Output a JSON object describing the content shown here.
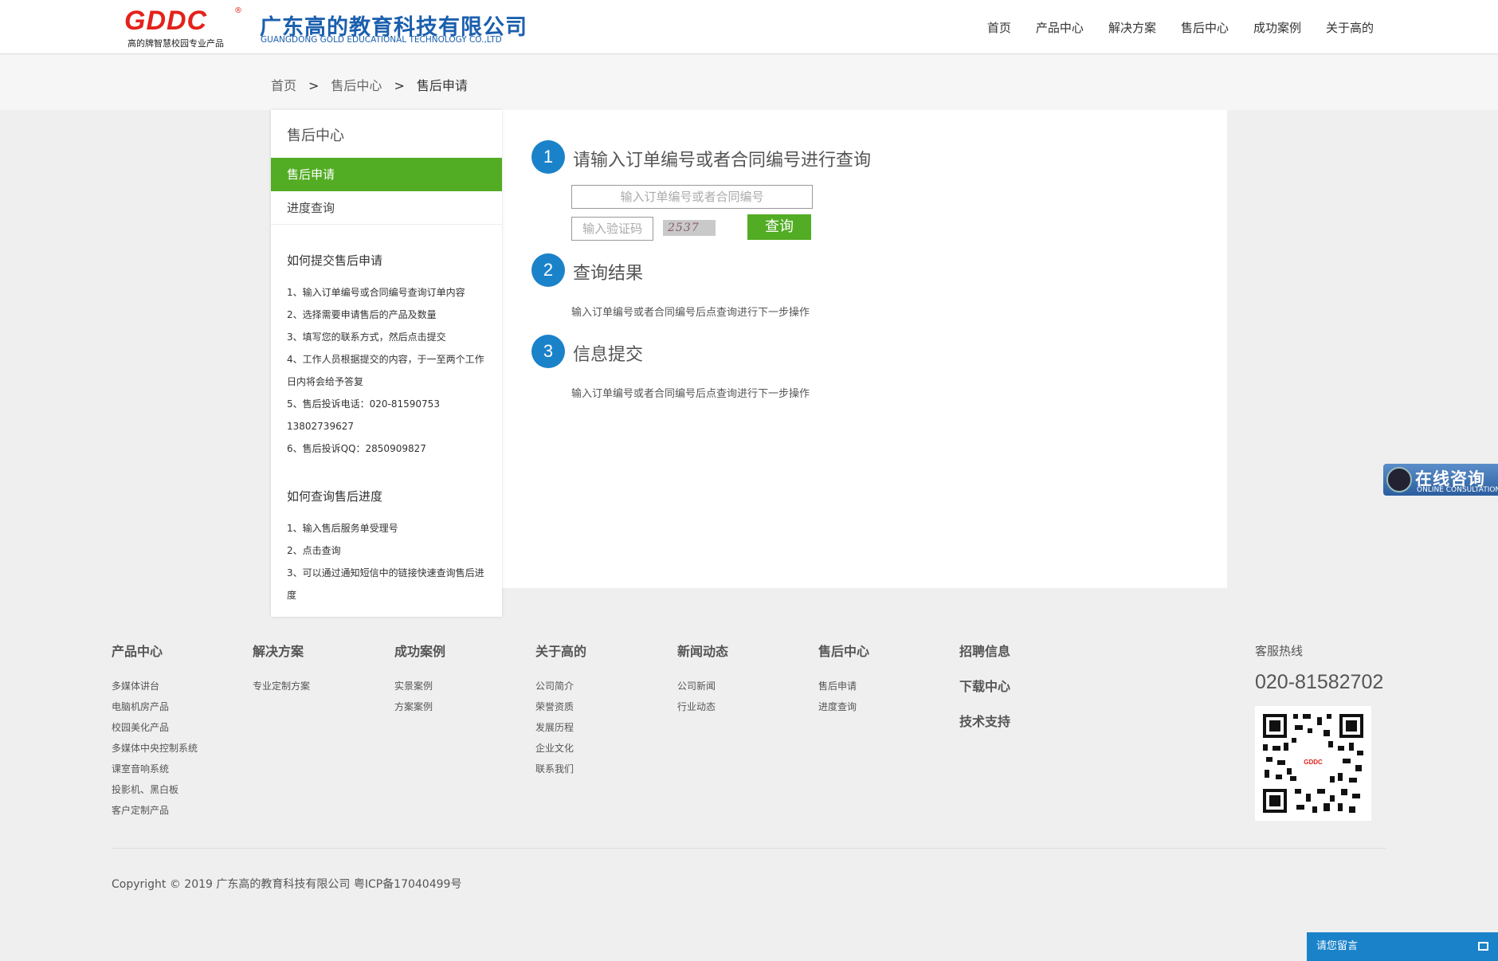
{
  "header": {
    "logo_mark": "GDDC",
    "logo_reg": "®",
    "logo_sub": "高的牌智慧校园专业产品",
    "company_cn": "广东高的教育科技有限公司",
    "company_en": "GUANGDONG GOLD EDUCATIONAL TECHNOLOGY CO.,LTD",
    "nav": [
      "首页",
      "产品中心",
      "解决方案",
      "售后中心",
      "成功案例",
      "关于高的"
    ]
  },
  "breadcrumb": {
    "home": "首页",
    "sep": ">",
    "section": "售后中心",
    "current": "售后申请"
  },
  "sidebar": {
    "title": "售后中心",
    "items": [
      "售后申请",
      "进度查询"
    ],
    "howto_submit": {
      "title": "如何提交售后申请",
      "lines": [
        "1、输入订单编号或合同编号查询订单内容",
        "2、选择需要申请售后的产品及数量",
        "3、填写您的联系方式，然后点击提交",
        "4、工作人员根据提交的内容，于一至两个工作",
        "日内将会给予答复",
        "5、售后投诉电话：020-81590753",
        "13802739627",
        "6、售后投诉QQ：2850909827"
      ]
    },
    "howto_query": {
      "title": "如何查询售后进度",
      "lines": [
        "1、输入售后服务单受理号",
        "2、点击查询",
        "3、可以通过通知短信中的链接快速查询售后进",
        "度"
      ]
    }
  },
  "steps": [
    {
      "num": "1",
      "title": "请输入订单编号或者合同编号进行查询"
    },
    {
      "num": "2",
      "title": "查询结果"
    },
    {
      "num": "3",
      "title": "信息提交"
    }
  ],
  "form": {
    "order_placeholder": "输入订单编号或者合同编号",
    "code_placeholder": "输入验证码",
    "captcha": "2537",
    "query_button": "查询"
  },
  "hints": {
    "result": "输入订单编号或者合同编号后点查询进行下一步操作",
    "submit": "输入订单编号或者合同编号后点查询进行下一步操作"
  },
  "consult": {
    "cn": "在线咨询",
    "en": "ONLINE CONSULTATION"
  },
  "footer": {
    "cols": [
      {
        "title": "产品中心",
        "links": [
          "多媒体讲台",
          "电脑机房产品",
          "校园美化产品",
          "多媒体中央控制系统",
          "课室音响系统",
          "投影机、黑白板",
          "客户定制产品"
        ]
      },
      {
        "title": "解决方案",
        "links": [
          "专业定制方案"
        ]
      },
      {
        "title": "成功案例",
        "links": [
          "实景案例",
          "方案案例"
        ]
      },
      {
        "title": "关于高的",
        "links": [
          "公司简介",
          "荣誉资质",
          "发展历程",
          "企业文化",
          "联系我们"
        ]
      },
      {
        "title": "新闻动态",
        "links": [
          "公司新闻",
          "行业动态"
        ]
      },
      {
        "title": "售后中心",
        "links": [
          "售后申请",
          "进度查询"
        ]
      }
    ],
    "stack": [
      "招聘信息",
      "下载中心",
      "技术支持"
    ],
    "hotline_label": "客服热线",
    "hotline": "020-81582702",
    "qr_label": "GDDC",
    "copyright": "Copyright © 2019 广东高的教育科技有限公司 粤ICP备17040499号"
  },
  "message_bar": "请您留言"
}
